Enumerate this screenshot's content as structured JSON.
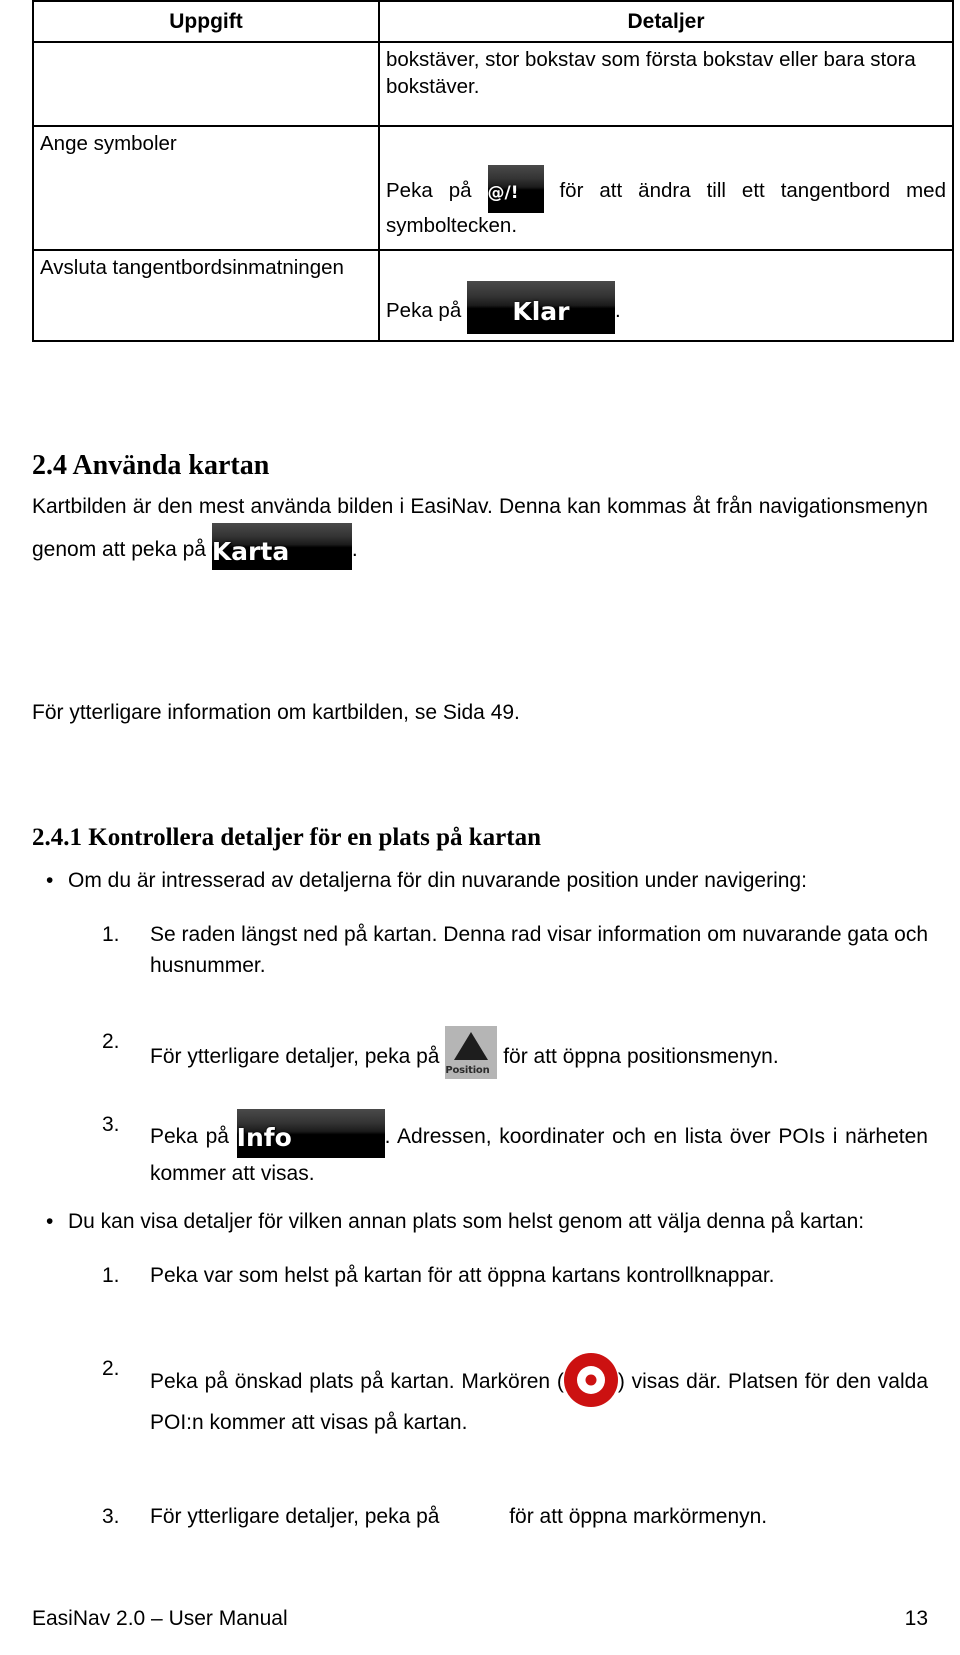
{
  "table": {
    "headers": {
      "task": "Uppgift",
      "details": "Detaljer"
    },
    "rows": [
      {
        "task": "",
        "details_text": "bokstäver, stor bokstav som första bokstav eller bara stora bokstäver."
      },
      {
        "task": "Ange symboler",
        "details_before": "Peka på",
        "button": "@/!",
        "details_after": "för att ändra till ett tangentbord med symboltecken."
      },
      {
        "task": "Avsluta tangentbordsinmatningen",
        "details_before": "Peka på",
        "button": "Klar",
        "details_after": "."
      }
    ]
  },
  "section": {
    "number_title": "2.4 Använda kartan",
    "intro_part1": "Kartbilden är den mest använda bilden i EasiNav. Denna kan kommas åt från navigationsmenyn genom att peka på",
    "intro_button": "Karta",
    "intro_part2": ".",
    "reference": "För ytterligare information om kartbilden, se Sida 49."
  },
  "subsection": {
    "number_title": "2.4.1 Kontrollera detaljer för en plats på kartan",
    "bullets": [
      {
        "bullet": "•",
        "text": "Om du är intresserad av detaljerna för din nuvarande position under navigering:",
        "items": [
          {
            "num": "1.",
            "text": "Se raden längst ned på kartan. Denna rad visar information om nuvarande gata och husnummer."
          },
          {
            "num": "2.",
            "before": "För ytterligare detaljer, peka på",
            "icon": "Position",
            "after": "för att öppna positionsmenyn."
          },
          {
            "num": "3.",
            "before": "Peka på",
            "button": "Info",
            "after": ". Adressen, koordinater och en lista över POIs i närheten kommer att visas."
          }
        ]
      },
      {
        "bullet": "•",
        "text": "Du kan visa detaljer för vilken annan plats som helst genom att välja denna på kartan:",
        "items": [
          {
            "num": "1.",
            "text": "Peka var som helst på kartan för att öppna kartans kontrollknappar."
          },
          {
            "num": "2.",
            "before": "Peka på önskad plats på kartan. Markören (",
            "icon": "marker",
            "after": ") visas där. Platsen för den valda POI:n kommer att visas på kartan."
          },
          {
            "num": "3.",
            "before": "För ytterligare detaljer, peka på",
            "button": "",
            "after": "för att öppna markörmenyn."
          }
        ]
      }
    ]
  },
  "footer": {
    "left": "EasiNav 2.0 – User Manual",
    "page": "13"
  },
  "colors": {
    "marker_red": "#cc1111",
    "button_black": "#000000",
    "position_gray": "#b5b5b5"
  }
}
